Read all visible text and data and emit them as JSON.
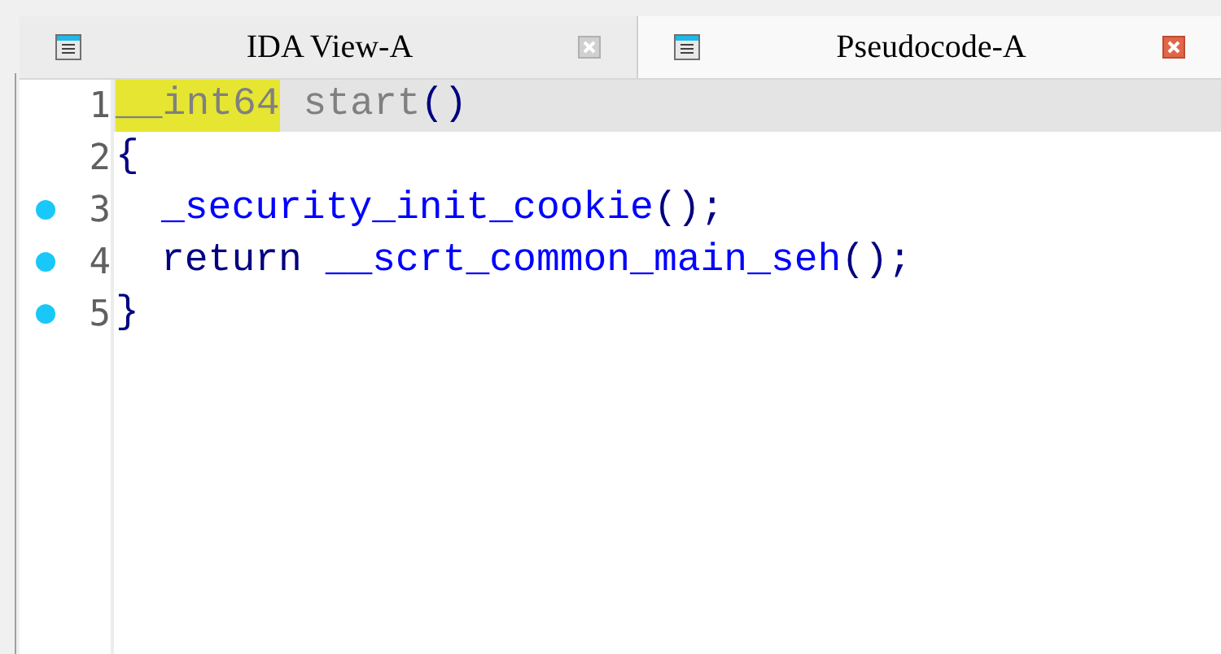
{
  "tabs": [
    {
      "title": "IDA View-A",
      "selected": false
    },
    {
      "title": "Pseudocode-A",
      "selected": true
    }
  ],
  "code_lines": [
    {
      "number": "1",
      "breakpoint": false,
      "current": true,
      "indented": false,
      "tokens": [
        {
          "text": "__int64",
          "kind": "name",
          "highlighted": true
        },
        {
          "text": " start",
          "kind": "name",
          "highlighted": false
        },
        {
          "text": "()",
          "kind": "punct",
          "highlighted": false
        }
      ]
    },
    {
      "number": "2",
      "breakpoint": false,
      "current": false,
      "indented": false,
      "tokens": [
        {
          "text": "{",
          "kind": "punct",
          "highlighted": false
        }
      ]
    },
    {
      "number": "3",
      "breakpoint": true,
      "current": false,
      "indented": true,
      "tokens": [
        {
          "text": "_security_init_cookie",
          "kind": "function",
          "highlighted": false
        },
        {
          "text": "();",
          "kind": "punct",
          "highlighted": false
        }
      ]
    },
    {
      "number": "4",
      "breakpoint": true,
      "current": false,
      "indented": true,
      "tokens": [
        {
          "text": "return",
          "kind": "keyword",
          "highlighted": false
        },
        {
          "text": " __scrt_common_main_seh",
          "kind": "function",
          "highlighted": false
        },
        {
          "text": "();",
          "kind": "punct",
          "highlighted": false
        }
      ]
    },
    {
      "number": "5",
      "breakpoint": true,
      "current": false,
      "indented": false,
      "tokens": [
        {
          "text": "}",
          "kind": "punct",
          "highlighted": false
        }
      ]
    }
  ]
}
